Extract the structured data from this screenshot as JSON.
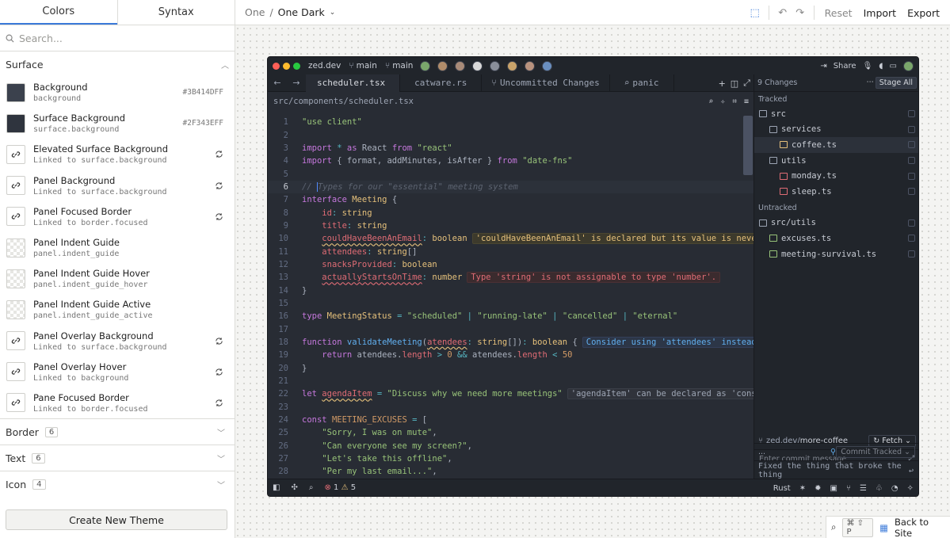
{
  "sidebar": {
    "tabs": [
      {
        "label": "Colors"
      },
      {
        "label": "Syntax"
      }
    ],
    "search_placeholder": "Search...",
    "section_title": "Surface",
    "tokens": [
      {
        "name": "Background",
        "sub": "background",
        "value": "#3B414DFF",
        "swatch": "#3b414d"
      },
      {
        "name": "Surface Background",
        "sub": "surface.background",
        "value": "#2F343EFF",
        "swatch": "#2f343e"
      },
      {
        "name": "Elevated Surface Background",
        "sub": "Linked to surface.background"
      },
      {
        "name": "Panel Background",
        "sub": "Linked to surface.background"
      },
      {
        "name": "Panel Focused Border",
        "sub": "Linked to border.focused"
      },
      {
        "name": "Panel Indent Guide",
        "sub": "panel.indent_guide"
      },
      {
        "name": "Panel Indent Guide Hover",
        "sub": "panel.indent_guide_hover"
      },
      {
        "name": "Panel Indent Guide Active",
        "sub": "panel.indent_guide_active"
      },
      {
        "name": "Panel Overlay Background",
        "sub": "Linked to surface.background"
      },
      {
        "name": "Panel Overlay Hover",
        "sub": "Linked to background"
      },
      {
        "name": "Pane Focused Border",
        "sub": "Linked to border.focused"
      }
    ],
    "collapsed": [
      {
        "label": "Border",
        "count": "6"
      },
      {
        "label": "Text",
        "count": "6"
      },
      {
        "label": "Icon",
        "count": "4"
      }
    ],
    "create_button": "Create New Theme"
  },
  "topbar": {
    "crumb_parent": "One",
    "crumb_sep": "/",
    "crumb_current": "One Dark",
    "reset": "Reset",
    "import": "Import",
    "export": "Export"
  },
  "editor": {
    "project": "zed.dev",
    "branch1": "main",
    "branch2": "main",
    "share": "Share",
    "tabs": [
      {
        "label": "scheduler.tsx"
      },
      {
        "label": "catware.rs"
      },
      {
        "label": "Uncommitted Changes"
      },
      {
        "label": "panic"
      }
    ],
    "path": "src/components/scheduler.tsx",
    "diagnostics": {
      "d10": "'couldHaveBeenAnEmail' is declared but its value is never read",
      "d13": "Type 'string' is not assignable to type 'number'.",
      "d18": "Consider using 'attendees' instead of 'a",
      "d22": "'agendaItem' can be declared as 'const' sin"
    },
    "status": {
      "errors": "1",
      "warnings": "5",
      "language": "Rust"
    }
  },
  "git": {
    "changes": "9 Changes",
    "stage_all": "Stage All",
    "tracked_label": "Tracked",
    "untracked_label": "Untracked",
    "tracked": [
      {
        "name": "src",
        "kind": "folder",
        "indent": 0
      },
      {
        "name": "services",
        "kind": "folder",
        "indent": 1
      },
      {
        "name": "coffee.ts",
        "kind": "mod",
        "indent": 2
      },
      {
        "name": "utils",
        "kind": "folder",
        "indent": 1
      },
      {
        "name": "monday.ts",
        "kind": "del",
        "indent": 2
      },
      {
        "name": "sleep.ts",
        "kind": "del",
        "indent": 2
      }
    ],
    "untracked": [
      {
        "name": "src/utils",
        "kind": "folder",
        "indent": 0
      },
      {
        "name": "excuses.ts",
        "kind": "add",
        "indent": 1
      },
      {
        "name": "meeting-survival.ts",
        "kind": "add",
        "indent": 1
      }
    ],
    "branch_prefix": "zed.dev/",
    "branch": "more-coffee",
    "fetch": "Fetch",
    "commit_placeholder": "Enter commit message",
    "commit_button": "Commit Tracked",
    "last_commit": "Fixed the thing that broke the thing",
    "more": "..."
  },
  "corner": {
    "shortcut": "⌘ ⇧ P",
    "back": "Back to Site"
  }
}
